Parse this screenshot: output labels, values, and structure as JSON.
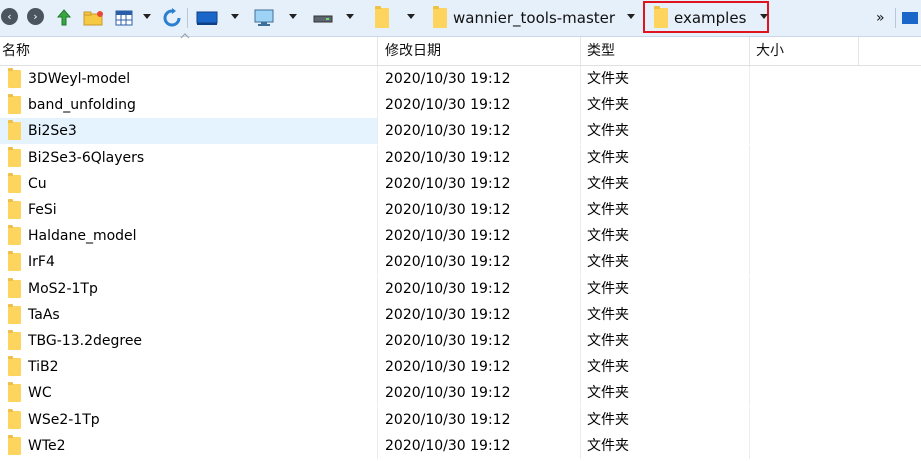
{
  "toolbar": {
    "breadcrumbs": [
      {
        "label": ""
      },
      {
        "label": "wannier_tools-master"
      },
      {
        "label": "examples"
      }
    ],
    "overflow_label": "»",
    "icons": [
      "back-icon",
      "forward-icon",
      "up-icon",
      "new-folder-icon",
      "view-icon",
      "refresh-icon",
      "desktop-icon",
      "computer-icon",
      "drive-icon",
      "folder-icon"
    ]
  },
  "columns": {
    "name": "名称",
    "modified": "修改日期",
    "type": "类型",
    "size": "大小"
  },
  "files": [
    {
      "name": "3DWeyl-model",
      "modified": "2020/10/30 19:12",
      "type": "文件夹",
      "size": ""
    },
    {
      "name": "band_unfolding",
      "modified": "2020/10/30 19:12",
      "type": "文件夹",
      "size": ""
    },
    {
      "name": "Bi2Se3",
      "modified": "2020/10/30 19:12",
      "type": "文件夹",
      "size": ""
    },
    {
      "name": "Bi2Se3-6Qlayers",
      "modified": "2020/10/30 19:12",
      "type": "文件夹",
      "size": ""
    },
    {
      "name": "Cu",
      "modified": "2020/10/30 19:12",
      "type": "文件夹",
      "size": ""
    },
    {
      "name": "FeSi",
      "modified": "2020/10/30 19:12",
      "type": "文件夹",
      "size": ""
    },
    {
      "name": "Haldane_model",
      "modified": "2020/10/30 19:12",
      "type": "文件夹",
      "size": ""
    },
    {
      "name": "IrF4",
      "modified": "2020/10/30 19:12",
      "type": "文件夹",
      "size": ""
    },
    {
      "name": "MoS2-1Tp",
      "modified": "2020/10/30 19:12",
      "type": "文件夹",
      "size": ""
    },
    {
      "name": "TaAs",
      "modified": "2020/10/30 19:12",
      "type": "文件夹",
      "size": ""
    },
    {
      "name": "TBG-13.2degree",
      "modified": "2020/10/30 19:12",
      "type": "文件夹",
      "size": ""
    },
    {
      "name": "TiB2",
      "modified": "2020/10/30 19:12",
      "type": "文件夹",
      "size": ""
    },
    {
      "name": "WC",
      "modified": "2020/10/30 19:12",
      "type": "文件夹",
      "size": ""
    },
    {
      "name": "WSe2-1Tp",
      "modified": "2020/10/30 19:12",
      "type": "文件夹",
      "size": ""
    },
    {
      "name": "WTe2",
      "modified": "2020/10/30 19:12",
      "type": "文件夹",
      "size": ""
    }
  ],
  "selected_index": 2
}
